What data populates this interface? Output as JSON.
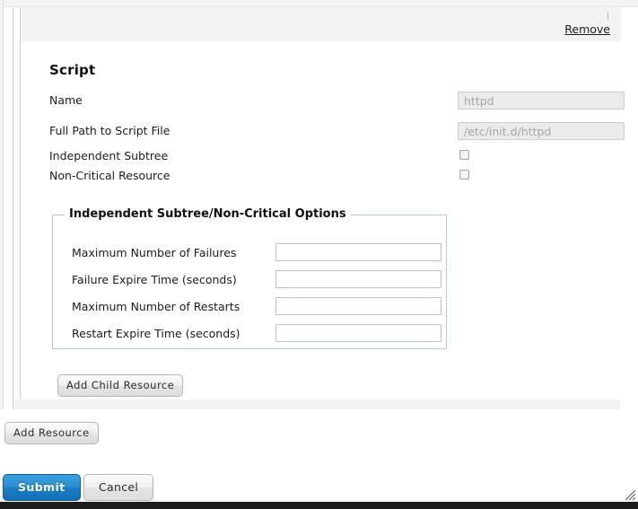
{
  "resource": {
    "remove_label": "Remove",
    "section_title": "Script",
    "fields": [
      {
        "label": "Name",
        "type": "text",
        "value": "",
        "placeholder": "httpd"
      },
      {
        "label": "Full Path to Script File",
        "type": "text",
        "value": "",
        "placeholder": "/etc/init.d/httpd"
      },
      {
        "label": "Independent Subtree",
        "type": "checkbox",
        "checked": false
      },
      {
        "label": "Non-Critical Resource",
        "type": "checkbox",
        "checked": false
      }
    ],
    "options_fieldset": {
      "legend": "Independent Subtree/Non-Critical Options",
      "rows": [
        {
          "label": "Maximum Number of Failures",
          "value": "",
          "placeholder": ""
        },
        {
          "label": "Failure Expire Time (seconds)",
          "value": "",
          "placeholder": ""
        },
        {
          "label": "Maximum Number of Restarts",
          "value": "",
          "placeholder": ""
        },
        {
          "label": "Restart Expire Time (seconds)",
          "value": "",
          "placeholder": ""
        }
      ]
    },
    "add_child_label": "Add Child Resource"
  },
  "actions": {
    "add_resource_label": "Add Resource",
    "submit_label": "Submit",
    "cancel_label": "Cancel"
  },
  "colors": {
    "submit_blue": "#1b7cc3",
    "header_grey": "#f3f3f3",
    "fieldset_border": "#bac6cf",
    "disabled_input_bg": "#ebebeb"
  },
  "icons": {
    "resize_grip": "resize-grip-icon"
  }
}
